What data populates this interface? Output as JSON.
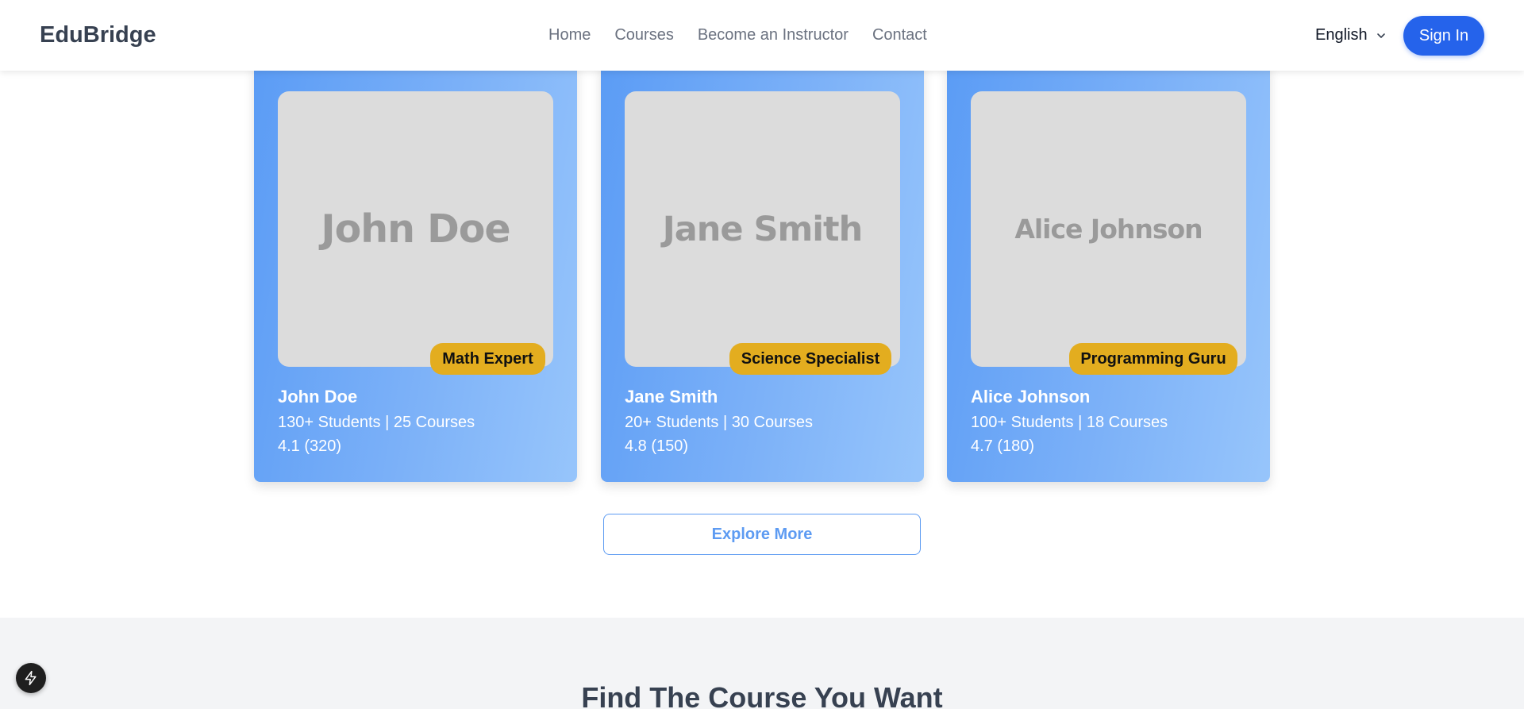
{
  "header": {
    "logo": "EduBridge",
    "nav": [
      "Home",
      "Courses",
      "Become an Instructor",
      "Contact"
    ],
    "language": "English",
    "sign_in": "Sign In"
  },
  "instructors": [
    {
      "photo_text": "John Doe",
      "badge": "Math Expert",
      "name": "John Doe",
      "stats": "130+ Students | 25 Courses",
      "rating": "4.1 (320)"
    },
    {
      "photo_text": "Jane Smith",
      "badge": "Science Specialist",
      "name": "Jane Smith",
      "stats": "20+ Students | 30 Courses",
      "rating": "4.8 (150)"
    },
    {
      "photo_text": "Alice Johnson",
      "badge": "Programming Guru",
      "name": "Alice Johnson",
      "stats": "100+ Students | 18 Courses",
      "rating": "4.7 (180)"
    }
  ],
  "explore_more": "Explore More",
  "courses_section": {
    "title": "Find The Course You Want"
  },
  "fab_icon": "lightning-icon",
  "colors": {
    "primary": "#2563eb",
    "card_gradient_start": "#5b9cf5",
    "card_gradient_end": "#97c5fb",
    "badge": "#e3ad1f",
    "explore_accent": "#5d9bf2"
  }
}
